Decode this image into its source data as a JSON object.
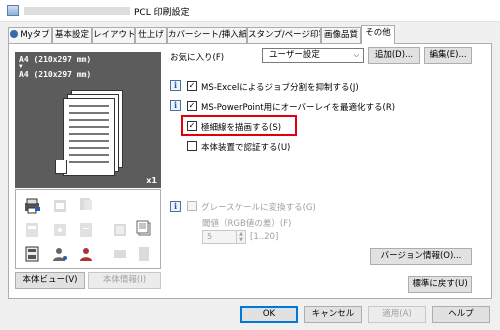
{
  "window": {
    "title": "PCL 印刷設定"
  },
  "tabs": [
    {
      "label": "Myタブ",
      "icon": "user-tab-icon"
    },
    {
      "label": "基本設定"
    },
    {
      "label": "レイアウト"
    },
    {
      "label": "仕上げ"
    },
    {
      "label": "カバーシート/挿入紙"
    },
    {
      "label": "スタンプ/ページ印字"
    },
    {
      "label": "画像品質"
    },
    {
      "label": "その他"
    }
  ],
  "active_tab": "その他",
  "preview": {
    "paper_size_1": "A4 (210x297 mm)",
    "arrow": "▼",
    "paper_size_2": "A4 (210x297 mm)",
    "zoom": "x1"
  },
  "left_buttons": {
    "body_view": "本体ビュー(V)",
    "body_info": "本体情報(I)"
  },
  "favorites": {
    "label": "お気に入り(F)",
    "selected": "ユーザー設定",
    "add": "追加(D)...",
    "edit": "編集(E)..."
  },
  "options": {
    "excel": "MS-Excelによるジョブ分割を抑制する(J)",
    "ppt": "MS-PowerPoint用にオーバーレイを最適化する(R)",
    "thin_line": "極細線を描画する(S)",
    "auth": "本体装置で認証する(U)",
    "grayscale": "グレースケールに変換する(G)",
    "threshold_label": "閾値（RGB値の差）(F)",
    "threshold_value": "5",
    "threshold_range": "[1..20]"
  },
  "buttons": {
    "version": "バージョン情報(O)...",
    "reset": "標準に戻す(U)",
    "ok": "OK",
    "cancel": "キャンセル",
    "apply": "適用(A)",
    "help": "ヘルプ"
  },
  "colors": {
    "highlight": "#e0000d",
    "preview_bg": "#5c5c5c",
    "focus": "#0078d7"
  }
}
